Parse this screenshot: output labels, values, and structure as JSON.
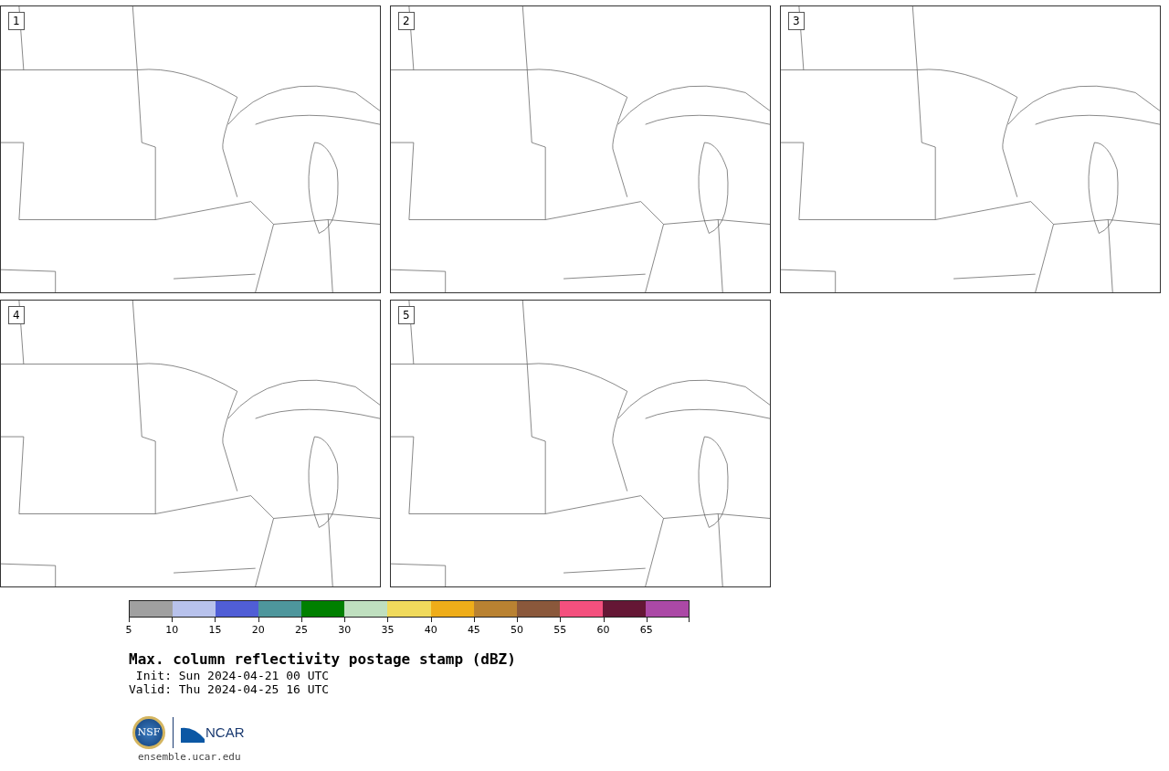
{
  "panels": [
    {
      "label": "1"
    },
    {
      "label": "2"
    },
    {
      "label": "3"
    },
    {
      "label": "4"
    },
    {
      "label": "5"
    }
  ],
  "colorbar": {
    "bins": [
      {
        "color": "#a0a0a0"
      },
      {
        "color": "#b8c2ec"
      },
      {
        "color": "#505ed6"
      },
      {
        "color": "#4e969c"
      },
      {
        "color": "#008000"
      },
      {
        "color": "#bfdfbf"
      },
      {
        "color": "#f0da5c"
      },
      {
        "color": "#efad19"
      },
      {
        "color": "#b98232"
      },
      {
        "color": "#8a583b"
      },
      {
        "color": "#f4507e"
      },
      {
        "color": "#651735"
      },
      {
        "color": "#ab49a6"
      }
    ],
    "ticks": [
      "5",
      "10",
      "15",
      "20",
      "25",
      "30",
      "35",
      "40",
      "45",
      "50",
      "55",
      "60",
      "65"
    ]
  },
  "title": "Max. column reflectivity postage stamp (dBZ)",
  "init": " Init: Sun 2024-04-21 00 UTC",
  "valid": "Valid: Thu 2024-04-25 16 UTC",
  "logos": {
    "left": "NSF",
    "right": "NCAR"
  },
  "url": "ensemble.ucar.edu"
}
